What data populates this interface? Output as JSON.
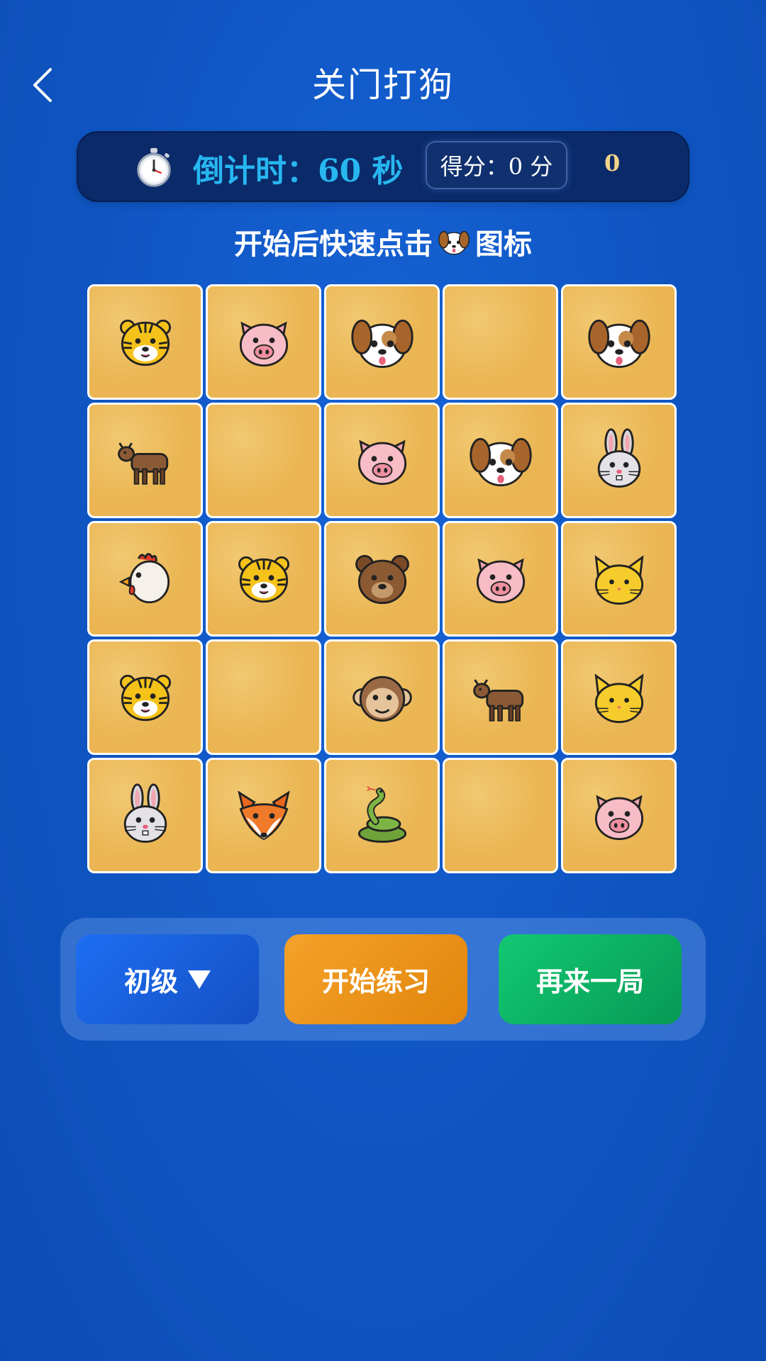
{
  "header": {
    "title": "关门打狗"
  },
  "status": {
    "timer_label": "倒计时：60 秒",
    "score_label": "得分：0 分",
    "score_value": "0"
  },
  "instruction": {
    "before": "开始后快速点击",
    "after": "图标"
  },
  "colors": {
    "background": "#0f55c2",
    "cell": "#eab552",
    "timer_text": "#27b6f0",
    "score_number": "#f2d48a",
    "level_button": "#1e6ef2",
    "start_button": "#f4a22a",
    "again_button": "#12c872"
  },
  "grid": {
    "rows": [
      [
        "tiger",
        "pig",
        "dog",
        "empty",
        "dog"
      ],
      [
        "cow",
        "empty",
        "pig",
        "dog",
        "rabbit"
      ],
      [
        "chicken",
        "tiger",
        "bear",
        "pig",
        "cat"
      ],
      [
        "tiger",
        "empty",
        "monkey",
        "cow",
        "cat"
      ],
      [
        "rabbit",
        "fox",
        "snake",
        "empty",
        "pig"
      ]
    ]
  },
  "controls": {
    "level_label": "初级",
    "start_label": "开始练习",
    "again_label": "再来一局"
  }
}
